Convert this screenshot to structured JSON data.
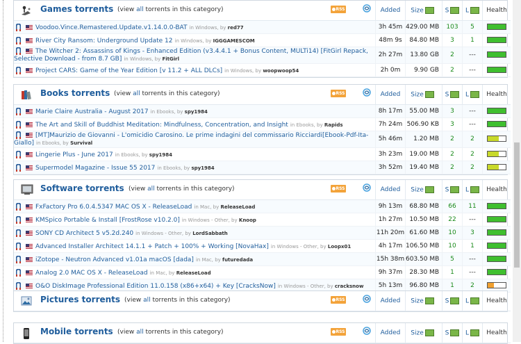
{
  "columns": {
    "added": "Added",
    "size": "Size",
    "seeds": "S",
    "leechers": "L",
    "health": "Health"
  },
  "view_all": {
    "pre": "(view ",
    "link": "all",
    "post": " torrents in this category)"
  },
  "rss_label": "RSS",
  "in_word": "in",
  "by_word": ", by",
  "colors": {
    "link": "#1f5d9c",
    "health_full": "#3fbf2f",
    "health_high": "#c8d92a",
    "health_mid": "#f0a030"
  },
  "categories": [
    {
      "id": "games",
      "title": "Games torrents",
      "icon": "joystick-icon",
      "torrents": [
        {
          "name": "Voodoo.Vince.Remastered.Update.v1.14.0.0-BAT",
          "category": "Windows",
          "uploader": "red77",
          "added": "3h 45m",
          "size": "429.00 MB",
          "seeds": "103",
          "leechers": "5",
          "health": 1.0
        },
        {
          "name": "River City Ransom: Underground Update 12",
          "category": "Windows",
          "uploader": "IGGGAMESCOM",
          "added": "48m 9s",
          "size": "84.80 MB",
          "seeds": "3",
          "leechers": "1",
          "health": 1.0
        },
        {
          "name": "The Witcher 2: Assassins of Kings - Enhanced Edition (v3.4.4.1 + Bonus Content, MULTi14) [FitGirl Repack, Selective Download - from 8.7 GB]",
          "category": "Windows",
          "uploader": "FitGirl",
          "added": "2h 27m",
          "size": "13.80 GB",
          "seeds": "2",
          "leechers": "---",
          "health": 1.0,
          "wrap": true
        },
        {
          "name": "Project CARS: Game of the Year Edition [v 11.2 + ALL DLCs]",
          "category": "Windows",
          "uploader": "woopwoop54",
          "added": "2h 0m",
          "size": "9.90 GB",
          "seeds": "2",
          "leechers": "---",
          "health": 1.0
        }
      ]
    },
    {
      "id": "books",
      "title": "Books torrents",
      "icon": "books-icon",
      "torrents": [
        {
          "name": "Marie Claire Australia - August 2017",
          "category": "Ebooks",
          "uploader": "spy1984",
          "added": "8h 17m",
          "size": "55.00 MB",
          "seeds": "3",
          "leechers": "---",
          "health": 1.0
        },
        {
          "name": "The Art and Skill of Buddhist Meditation: Mindfulness, Concentration, and Insight",
          "category": "Ebooks",
          "uploader": "Rapids",
          "added": "7h 24m",
          "size": "506.90 KB",
          "seeds": "3",
          "leechers": "---",
          "health": 1.0
        },
        {
          "name": "[MT]Maurizio de Giovanni - L'omicidio Carosino. Le prime indagini del commissario Ricciardi[Ebook-Pdf-Ita-Giallo]",
          "category": "Ebooks",
          "uploader": "Survival",
          "added": "5h 46m",
          "size": "1.20 MB",
          "seeds": "2",
          "leechers": "2",
          "health": 0.6,
          "wrap": true
        },
        {
          "name": "Lingerie Plus - June 2017",
          "category": "Ebooks",
          "uploader": "spy1984",
          "added": "3h 23m",
          "size": "19.00 MB",
          "seeds": "2",
          "leechers": "2",
          "health": 0.6
        },
        {
          "name": "Supermodel Magazine - Issue 55 2017",
          "category": "Ebooks",
          "uploader": "spy1984",
          "added": "3h 52m",
          "size": "19.40 MB",
          "seeds": "2",
          "leechers": "2",
          "health": 0.6
        }
      ]
    },
    {
      "id": "software",
      "title": "Software torrents",
      "icon": "software-icon",
      "torrents": [
        {
          "name": "FxFactory Pro 6.0.4.5347 MAC OS X - ReleaseLoad",
          "category": "Mac",
          "uploader": "ReleaseLoad",
          "added": "9h 13m",
          "size": "68.80 MB",
          "seeds": "66",
          "leechers": "11",
          "health": 1.0
        },
        {
          "name": "KMSpico Portable & Install [FrostRose v10.2.0]",
          "category": "Windows - Other",
          "uploader": "Knoop",
          "added": "1h 27m",
          "size": "10.50 MB",
          "seeds": "22",
          "leechers": "---",
          "health": 1.0
        },
        {
          "name": "SONY CD Architect 5 v5.2d.240",
          "category": "Windows - Other",
          "uploader": "LordSabbath",
          "added": "11h 20m",
          "size": "61.60 MB",
          "seeds": "10",
          "leechers": "3",
          "health": 1.0
        },
        {
          "name": "Advanced Installer Architect 14.1.1 + Patch + 100% + Working [NovaHax]",
          "category": "Windows - Other",
          "uploader": "Loopx01",
          "added": "4h 17m",
          "size": "106.50 MB",
          "seeds": "10",
          "leechers": "1",
          "health": 1.0
        },
        {
          "name": "iZotope - Neutron Advanced v1.01a macOS [dada]",
          "category": "Mac",
          "uploader": "futuredada",
          "added": "15h 38m",
          "size": "603.50 MB",
          "seeds": "5",
          "leechers": "---",
          "health": 1.0
        },
        {
          "name": "Analog 2.0 MAC OS X - ReleaseLoad",
          "category": "Mac",
          "uploader": "ReleaseLoad",
          "added": "9h 37m",
          "size": "28.30 MB",
          "seeds": "1",
          "leechers": "---",
          "health": 1.0
        },
        {
          "name": "O&O DiskImage Professional Edition 11.0.158 (x86+x64) + Key [CracksNow]",
          "category": "Windows - Other",
          "uploader": "cracksnow",
          "added": "5h 13m",
          "size": "96.80 MB",
          "seeds": "1",
          "leechers": "2",
          "health": 0.35
        }
      ]
    },
    {
      "id": "pictures",
      "title": "Pictures torrents",
      "icon": "pictures-icon",
      "torrents": []
    },
    {
      "id": "mobile",
      "title": "Mobile torrents",
      "icon": "mobile-phone-icon",
      "torrents": []
    }
  ]
}
